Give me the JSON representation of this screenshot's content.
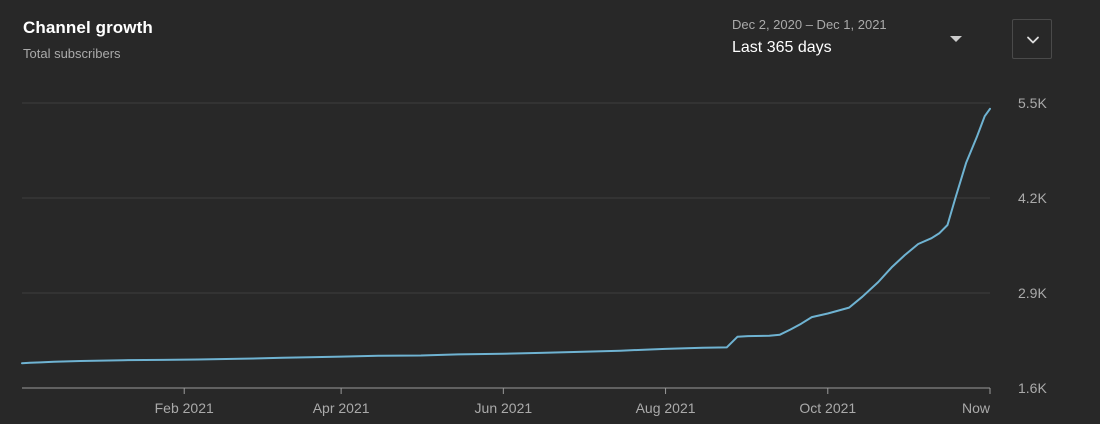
{
  "header": {
    "title": "Channel growth",
    "subtitle": "Total subscribers"
  },
  "range": {
    "dates": "Dec 2, 2020 – Dec 1, 2021",
    "label": "Last 365 days"
  },
  "icons": {
    "range_dropdown": "caret-down-icon",
    "expand": "chevron-down-icon"
  },
  "colors": {
    "background": "#282828",
    "line": "#6fb3d2",
    "grid": "#3e3e3e",
    "axis": "#9a9a9a"
  },
  "chart_data": {
    "type": "line",
    "title": "Channel growth",
    "subtitle": "Total subscribers",
    "xlabel": "",
    "ylabel": "",
    "xlim": [
      "2020-12-02",
      "2021-12-01"
    ],
    "ylim": [
      1600,
      5500
    ],
    "grid": true,
    "legend": "none",
    "y_ticks": [
      {
        "value": 5500,
        "label": "5.5K"
      },
      {
        "value": 4200,
        "label": "4.2K"
      },
      {
        "value": 2900,
        "label": "2.9K"
      },
      {
        "value": 1600,
        "label": "1.6K"
      }
    ],
    "x_ticks": [
      {
        "date": "2021-02-01",
        "label": "Feb 2021"
      },
      {
        "date": "2021-04-01",
        "label": "Apr 2021"
      },
      {
        "date": "2021-06-01",
        "label": "Jun 2021"
      },
      {
        "date": "2021-08-01",
        "label": "Aug 2021"
      },
      {
        "date": "2021-10-01",
        "label": "Oct 2021"
      },
      {
        "date": "2021-12-01",
        "label": "Now"
      }
    ],
    "series": [
      {
        "name": "",
        "x": [
          "2020-12-02",
          "2020-12-05",
          "2020-12-09",
          "2020-12-14",
          "2020-12-24",
          "2021-01-09",
          "2021-01-24",
          "2021-02-06",
          "2021-02-22",
          "2021-03-01",
          "2021-03-10",
          "2021-03-20",
          "2021-04-01",
          "2021-04-15",
          "2021-05-01",
          "2021-05-15",
          "2021-06-01",
          "2021-06-15",
          "2021-07-01",
          "2021-07-15",
          "2021-07-25",
          "2021-08-01",
          "2021-08-15",
          "2021-08-24",
          "2021-08-28",
          "2021-09-01",
          "2021-09-09",
          "2021-09-13",
          "2021-09-17",
          "2021-09-21",
          "2021-09-25",
          "2021-10-01",
          "2021-10-09",
          "2021-10-14",
          "2021-10-20",
          "2021-10-25",
          "2021-10-30",
          "2021-11-04",
          "2021-11-09",
          "2021-11-12",
          "2021-11-15",
          "2021-11-18",
          "2021-11-22",
          "2021-11-26",
          "2021-11-29",
          "2021-12-01"
        ],
        "y": [
          1940,
          1945,
          1950,
          1960,
          1970,
          1980,
          1985,
          1990,
          2000,
          2005,
          2015,
          2020,
          2030,
          2040,
          2045,
          2060,
          2070,
          2080,
          2095,
          2110,
          2125,
          2135,
          2150,
          2155,
          2300,
          2310,
          2315,
          2330,
          2400,
          2480,
          2570,
          2620,
          2700,
          2850,
          3050,
          3250,
          3420,
          3570,
          3650,
          3720,
          3830,
          4200,
          4680,
          5030,
          5320,
          5420
        ]
      }
    ]
  }
}
